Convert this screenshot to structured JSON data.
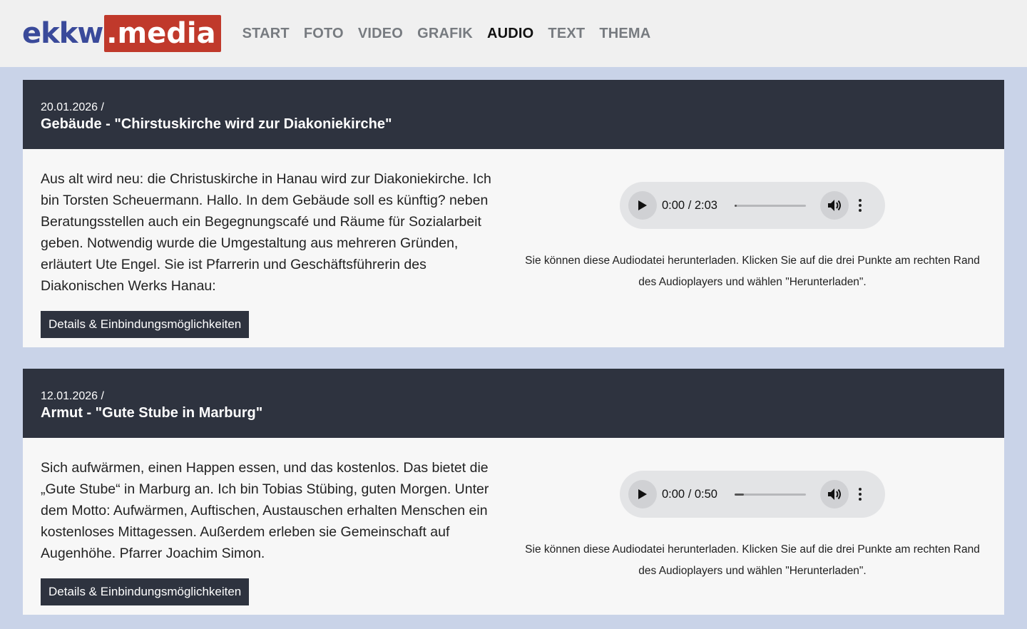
{
  "header": {
    "logo_part1": "ekkw",
    "logo_part2": ".media",
    "nav": [
      {
        "label": "START"
      },
      {
        "label": "FOTO"
      },
      {
        "label": "VIDEO"
      },
      {
        "label": "GRAFIK"
      },
      {
        "label": "AUDIO",
        "active": true
      },
      {
        "label": "TEXT"
      },
      {
        "label": "THEMA"
      }
    ]
  },
  "colors": {
    "page_background": "#c9d3e8",
    "card_header": "#2e333f",
    "logo_accent": "#c0392b",
    "logo_blue": "#3a4a9a"
  },
  "items": [
    {
      "date": "20.01.2026 /",
      "title": "Gebäude - \"Chirstuskirche wird zur Diakoniekirche\"",
      "description": "Aus alt wird neu: die Christuskirche in Hanau wird zur Diakoniekirche. Ich bin Torsten Scheuermann. Hallo. In dem Gebäude soll es künftig? neben Beratungsstellen auch ein Begegnungscafé und Räume für Sozialarbeit geben. Notwendig wurde die Umgestaltung aus mehreren Gründen, erläutert Ute Engel. Sie ist Pfarrerin und Geschäftsführerin des Diakonischen Werks Hanau:",
      "button_label": "Details & Einbindungsmöglichkeiten",
      "player": {
        "time": "0:00 / 2:03",
        "progress": 0.03
      },
      "hint": "Sie können diese Audiodatei herunterladen. Klicken Sie auf die drei Punkte am rechten Rand des Audioplayers und wählen \"Herunterladen\"."
    },
    {
      "date": "12.01.2026 /",
      "title": "Armut - \"Gute Stube in Marburg\"",
      "description": "Sich aufwärmen, einen Happen essen, und das kostenlos. Das bietet die „Gute Stube“ in Marburg an. Ich bin Tobias Stübing, guten Morgen. Unter dem Motto: Aufwärmen, Auftischen, Austauschen erhalten Menschen ein kostenloses Mittagessen. Außerdem erleben sie Gemeinschaft auf Augenhöhe. Pfarrer Joachim Simon.",
      "button_label": "Details & Einbindungsmöglichkeiten",
      "player": {
        "time": "0:00 / 0:50",
        "progress": 0.13
      },
      "hint": "Sie können diese Audiodatei herunterladen. Klicken Sie auf die drei Punkte am rechten Rand des Audioplayers und wählen \"Herunterladen\"."
    }
  ]
}
